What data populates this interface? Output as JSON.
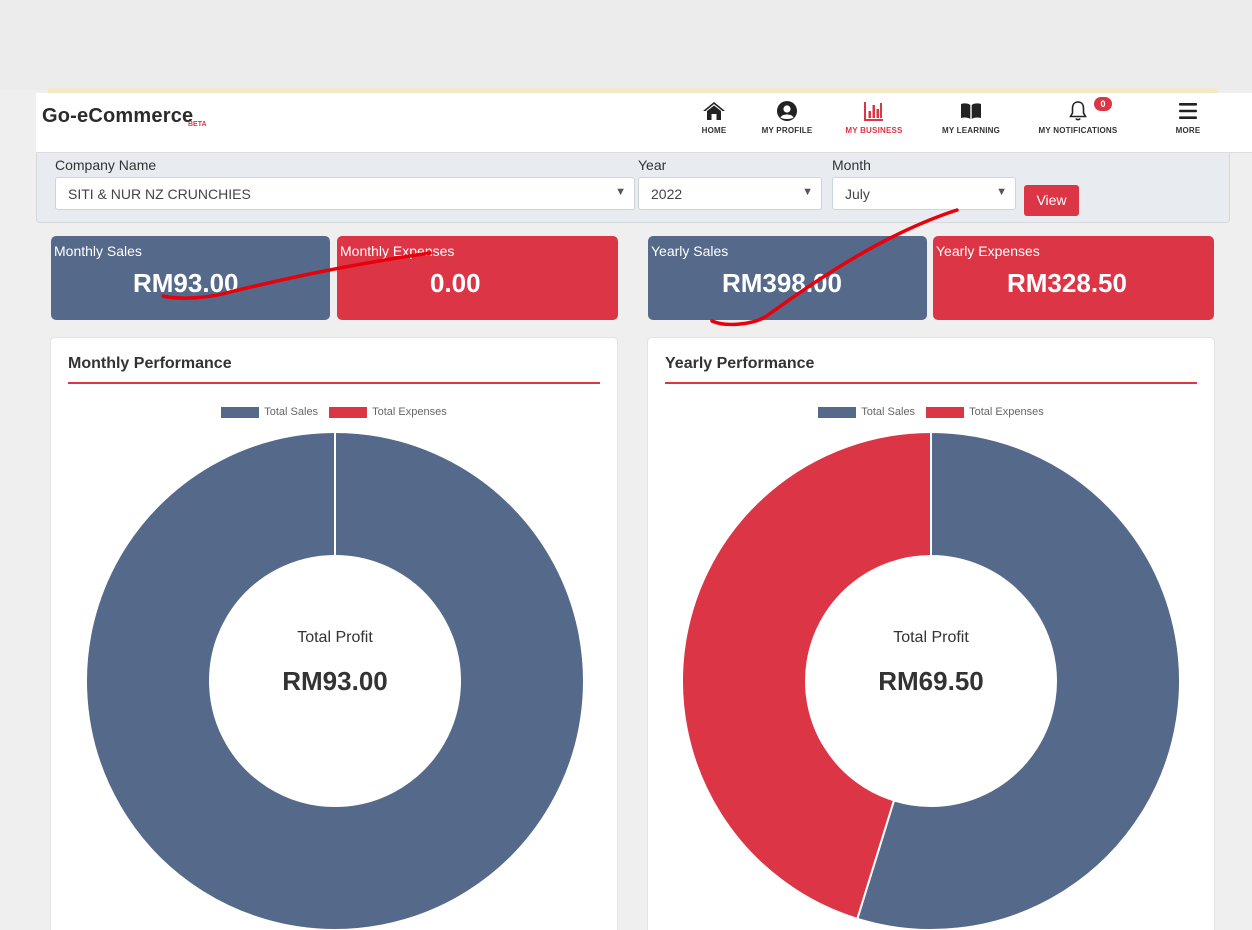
{
  "brand": {
    "name": "Go-eCommerce",
    "badge": "BETA"
  },
  "nav": [
    {
      "label": "HOME",
      "icon": "home-icon"
    },
    {
      "label": "MY PROFILE",
      "icon": "user-circle-icon"
    },
    {
      "label": "MY BUSINESS",
      "icon": "bar-chart-icon",
      "active": true
    },
    {
      "label": "MY LEARNING",
      "icon": "open-book-icon"
    },
    {
      "label": "MY NOTIFICATIONS",
      "icon": "bell-icon",
      "badge": "0"
    },
    {
      "label": "MORE",
      "icon": "hamburger-menu-icon"
    }
  ],
  "filters": {
    "company_label": "Company Name",
    "company_value": "SITI & NUR NZ CRUNCHIES",
    "year_label": "Year",
    "year_value": "2022",
    "month_label": "Month",
    "month_value": "July",
    "view_label": "View"
  },
  "stats": {
    "monthly_sales": {
      "label": "Monthly Sales",
      "value": "RM93.00"
    },
    "monthly_expenses": {
      "label": "Monthly Expenses",
      "value": "0.00"
    },
    "yearly_sales": {
      "label": "Yearly Sales",
      "value": "RM398.00"
    },
    "yearly_expenses": {
      "label": "Yearly Expenses",
      "value": "RM328.50"
    }
  },
  "monthly_card": {
    "title": "Monthly Performance",
    "center_label": "Total Profit",
    "center_value": "RM93.00"
  },
  "yearly_card": {
    "title": "Yearly Performance",
    "center_label": "Total Profit",
    "center_value": "RM69.50"
  },
  "legend": {
    "sales": "Total Sales",
    "expenses": "Total Expenses"
  },
  "colors": {
    "sales": "#55698a",
    "expenses": "#dc3545",
    "accent": "#dc3545"
  },
  "chart_data": [
    {
      "type": "pie",
      "title": "Monthly Performance",
      "categories": [
        "Total Sales",
        "Total Expenses"
      ],
      "values": [
        93.0,
        0.0
      ]
    },
    {
      "type": "pie",
      "title": "Yearly Performance",
      "categories": [
        "Total Sales",
        "Total Expenses"
      ],
      "values": [
        398.0,
        328.5
      ]
    }
  ]
}
